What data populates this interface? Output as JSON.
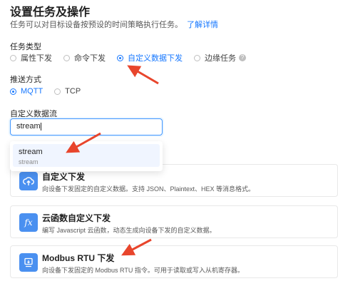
{
  "header": {
    "title": "设置任务及操作",
    "subtitle": "任务可以对目标设备按预设的时间策略执行任务。",
    "learn_more": "了解详情"
  },
  "task_type": {
    "label": "任务类型",
    "options": [
      {
        "label": "属性下发",
        "checked": false
      },
      {
        "label": "命令下发",
        "checked": false
      },
      {
        "label": "自定义数据下发",
        "checked": true
      },
      {
        "label": "边缘任务",
        "checked": false
      }
    ],
    "help_icon": "question-circle-icon"
  },
  "push_method": {
    "label": "推送方式",
    "options": [
      {
        "label": "MQTT",
        "checked": true
      },
      {
        "label": "TCP",
        "checked": false
      }
    ]
  },
  "stream": {
    "label": "自定义数据流",
    "input_value": "stream",
    "dropdown": [
      {
        "title": "stream",
        "subtitle": "stream"
      }
    ]
  },
  "cards": [
    {
      "icon": "cloud-upload-icon",
      "title": "自定义下发",
      "desc": "向设备下发固定的自定义数据。支持 JSON、Plaintext、HEX 等消息格式。"
    },
    {
      "icon": "function-icon",
      "title": "云函数自定义下发",
      "desc": "编写 Javascript 云函数，动态生成向设备下发的自定义数据。"
    },
    {
      "icon": "modbus-device-icon",
      "title": "Modbus RTU 下发",
      "desc": "向设备下发固定的 Modbus RTU 指令。可用于读取或写入从机寄存器。"
    }
  ],
  "colors": {
    "primary": "#1677ff",
    "arrow": "#e8452c",
    "icon_bg": "#4a90f0"
  }
}
